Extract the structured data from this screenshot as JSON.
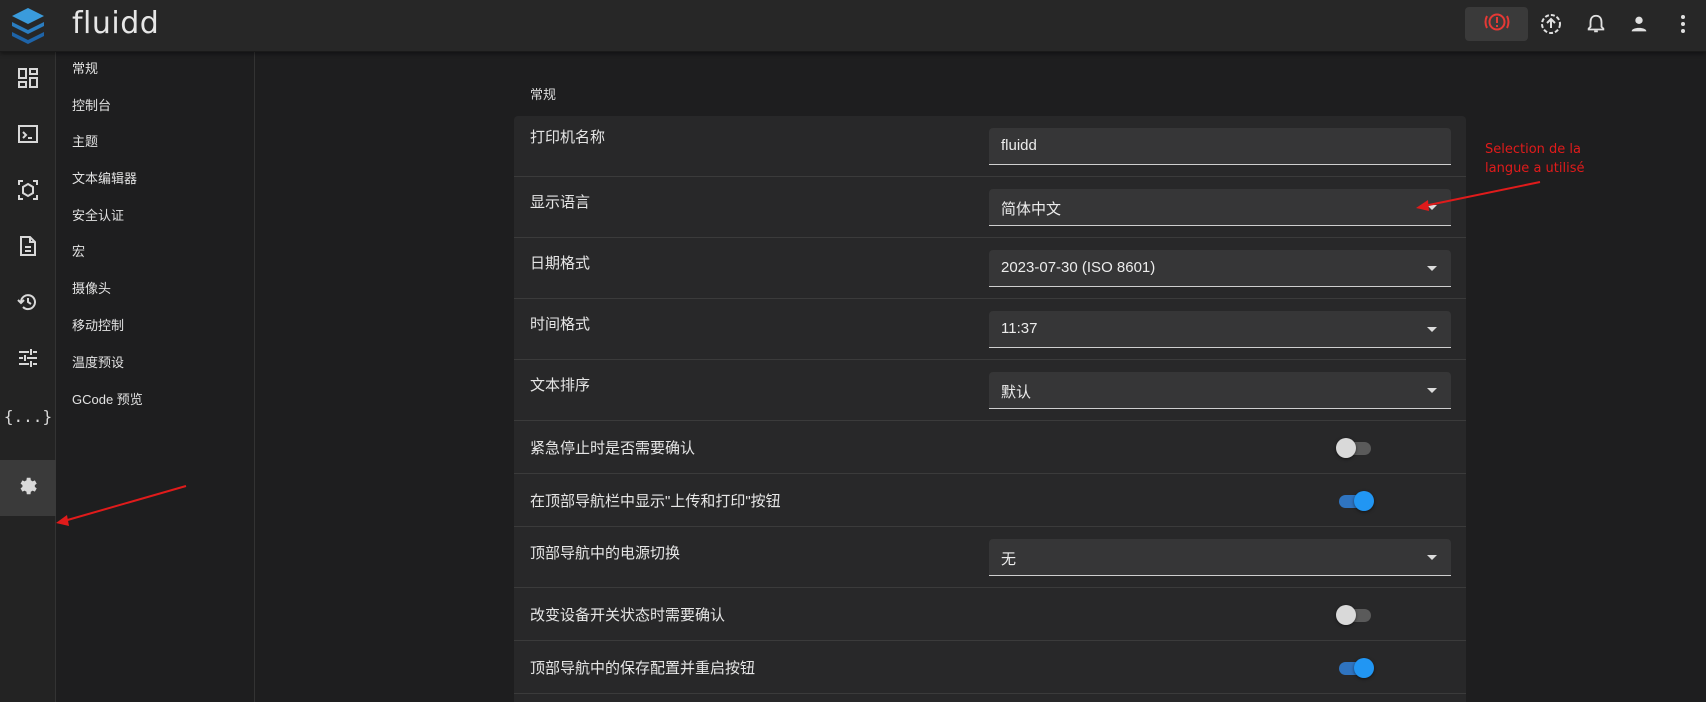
{
  "app": {
    "title": "fluidd"
  },
  "topbar_icons": [
    "emergency-stop-icon",
    "upload-icon",
    "bell-icon",
    "account-icon",
    "more-vert-icon"
  ],
  "sidebar_icons": [
    "dashboard-icon",
    "console-icon",
    "cube-icon",
    "file-icon",
    "history-icon",
    "tune-icon",
    "code-braces-icon",
    "device-icon",
    "gear-icon"
  ],
  "subnav": {
    "items": [
      "常规",
      "控制台",
      "主题",
      "文本编辑器",
      "安全认证",
      "宏",
      "摄像头",
      "移动控制",
      "温度预设",
      "GCode 预览"
    ]
  },
  "section": {
    "title": "常规"
  },
  "settings": {
    "printer_name": {
      "label": "打印机名称",
      "value": "fluidd"
    },
    "language": {
      "label": "显示语言",
      "value": "简体中文"
    },
    "date_format": {
      "label": "日期格式",
      "value": "2023-07-30 (ISO 8601)"
    },
    "time_format": {
      "label": "时间格式",
      "value": "11:37"
    },
    "text_sort": {
      "label": "文本排序",
      "value": "默认"
    },
    "estop_confirm": {
      "label": "紧急停止时是否需要确认",
      "enabled": false
    },
    "upload_print_button": {
      "label": "在顶部导航栏中显示\"上传和打印\"按钮",
      "enabled": true
    },
    "power_toggle": {
      "label": "顶部导航中的电源切换",
      "value": "无"
    },
    "device_switch_confirm": {
      "label": "改变设备开关状态时需要确认",
      "enabled": false
    },
    "save_restart_button": {
      "label": "顶部导航中的保存配置并重启按钮",
      "enabled": true
    }
  },
  "annotation": {
    "line1": "Selection de la",
    "line2": "langue a utilisé"
  },
  "colors": {
    "accent": "#2196f3",
    "annotation": "#e01b1b",
    "estop": "#e53935"
  }
}
